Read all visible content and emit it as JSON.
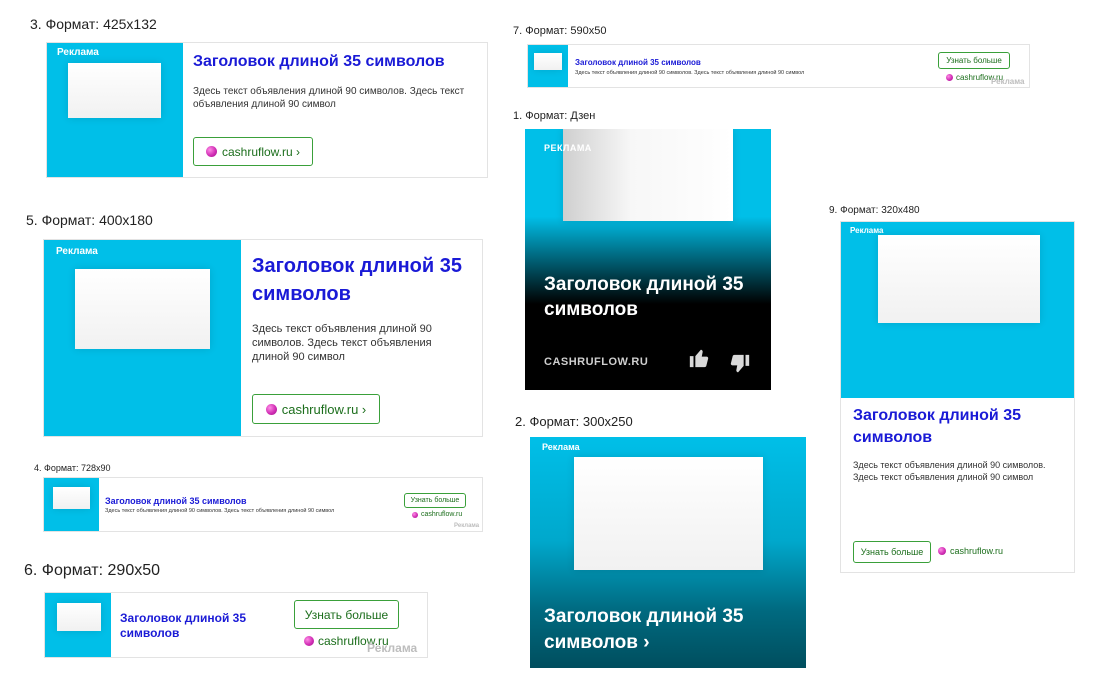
{
  "colors": {
    "cyan": "#00bfe8",
    "title_blue": "#1a1ad6",
    "domain_green": "#1c6e1c",
    "button_border": "#3aa03a",
    "dzen_bg": "#000000"
  },
  "ad_common": {
    "reklama": "Реклама",
    "reklama_caps": "РЕКЛАМА",
    "title": "Заголовок длиной 35 символов",
    "title_arrow": "Заголовок длиной 35 символов ›",
    "text": "Здесь текст объявления длиной 90 символов. Здесь текст объявления длиной 90 символ",
    "domain": "cashruflow.ru",
    "domain_link": "cashruflow.ru ›",
    "domain_caps": "CASHRUFLOW.RU",
    "learn_more": "Узнать больше"
  },
  "formats": {
    "f3": "3. Формат: 425x132",
    "f5": "5. Формат: 400x180",
    "f4": "4. Формат: 728x90",
    "f6": "6. Формат: 290x50",
    "f7": "7. Формат: 590x50",
    "f1": "1. Формат: Дзен",
    "f2": "2. Формат: 300x250",
    "f9": "9. Формат: 320x480"
  },
  "icons": {
    "like": "thumbs-up-icon",
    "dislike": "thumbs-down-icon",
    "favicon": "favicon-dot-icon"
  }
}
